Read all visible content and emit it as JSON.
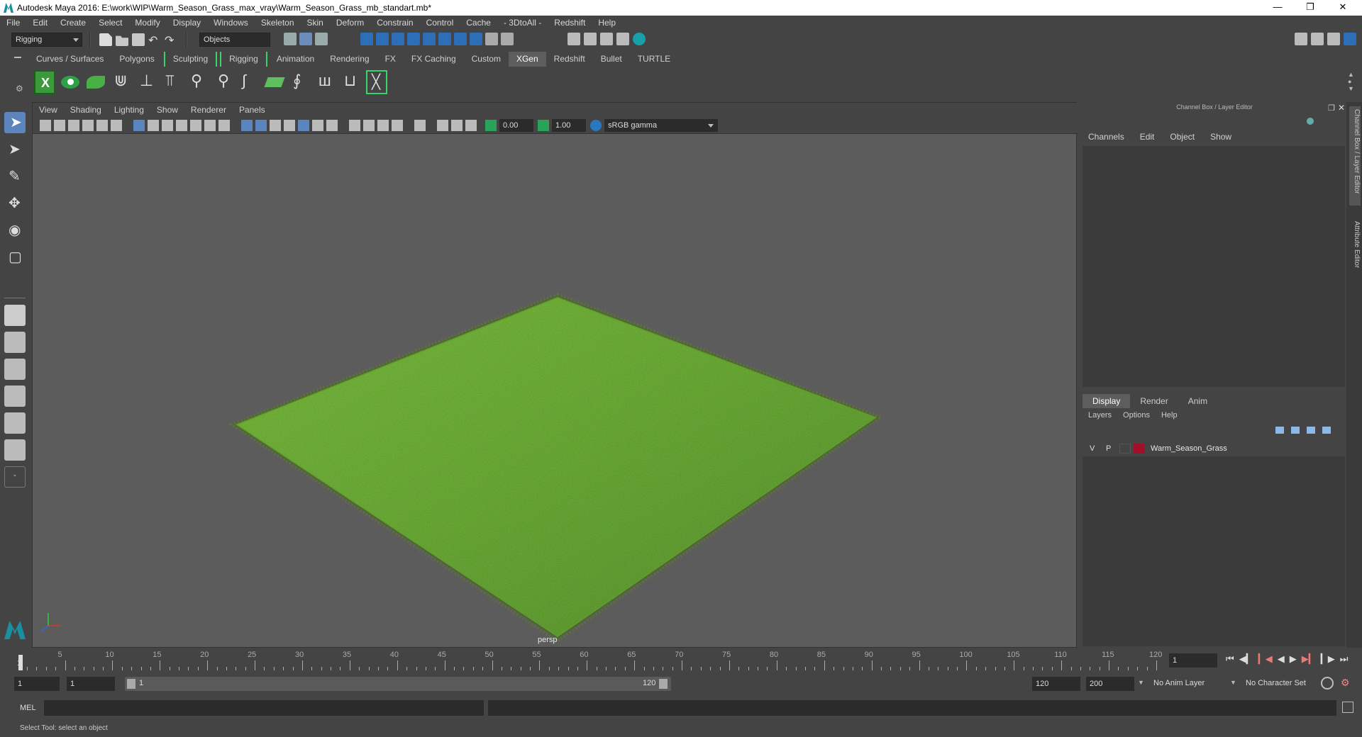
{
  "window": {
    "title": "Autodesk Maya 2016: E:\\work\\WIP\\Warm_Season_Grass_max_vray\\Warm_Season_Grass_mb_standart.mb*"
  },
  "menubar": [
    "File",
    "Edit",
    "Create",
    "Select",
    "Modify",
    "Display",
    "Windows",
    "Skeleton",
    "Skin",
    "Deform",
    "Constrain",
    "Control",
    "Cache",
    "- 3DtoAll -",
    "Redshift",
    "Help"
  ],
  "statusline": {
    "menuset": "Rigging",
    "selection_mode": "Objects"
  },
  "shelf_tabs": [
    {
      "label": "Curves / Surfaces",
      "active": false,
      "bracket": false
    },
    {
      "label": "Polygons",
      "active": false,
      "bracket": false
    },
    {
      "label": "Sculpting",
      "active": false,
      "bracket": true
    },
    {
      "label": "Rigging",
      "active": false,
      "bracket": true
    },
    {
      "label": "Animation",
      "active": false,
      "bracket": false
    },
    {
      "label": "Rendering",
      "active": false,
      "bracket": false
    },
    {
      "label": "FX",
      "active": false,
      "bracket": false
    },
    {
      "label": "FX Caching",
      "active": false,
      "bracket": false
    },
    {
      "label": "Custom",
      "active": false,
      "bracket": false
    },
    {
      "label": "XGen",
      "active": true,
      "bracket": false
    },
    {
      "label": "Redshift",
      "active": false,
      "bracket": false
    },
    {
      "label": "Bullet",
      "active": false,
      "bracket": false
    },
    {
      "label": "TURTLE",
      "active": false,
      "bracket": false
    }
  ],
  "viewport": {
    "menu": [
      "View",
      "Shading",
      "Lighting",
      "Show",
      "Renderer",
      "Panels"
    ],
    "exposure": "0.00",
    "gamma": "1.00",
    "color_space": "sRGB gamma",
    "camera_label": "persp",
    "colors": {
      "grass_dark": "#2f4a14",
      "grass_mid": "#4f7a23",
      "grass_light": "#6f9b34",
      "bg": "#5c5c5c"
    }
  },
  "channelbox": {
    "title": "Channel Box / Layer Editor",
    "menu": [
      "Channels",
      "Edit",
      "Object",
      "Show"
    ],
    "layer_tabs": [
      {
        "label": "Display",
        "active": true
      },
      {
        "label": "Render",
        "active": false
      },
      {
        "label": "Anim",
        "active": false
      }
    ],
    "layer_menu": [
      "Layers",
      "Options",
      "Help"
    ],
    "layers": [
      {
        "v": "V",
        "p": "P",
        "name": "Warm_Season_Grass",
        "color": "#a0102a"
      }
    ]
  },
  "side_tabs": [
    "Channel Box / Layer Editor",
    "Attribute Editor"
  ],
  "timeslider": {
    "start": 1,
    "end": 120,
    "current": 1,
    "tick_labels": [
      "5",
      "10",
      "15",
      "20",
      "25",
      "30",
      "35",
      "40",
      "45",
      "50",
      "55",
      "60",
      "65",
      "70",
      "75",
      "80",
      "85",
      "90",
      "95",
      "100",
      "105",
      "110",
      "115",
      "120"
    ],
    "current_frame_field": "1"
  },
  "range": {
    "start_field": "1",
    "playback_start": "1",
    "slider_start_label": "1",
    "slider_end_label": "120",
    "playback_end": "120",
    "end_field": "200",
    "anim_layer": "No Anim Layer",
    "character_set": "No Character Set"
  },
  "command": {
    "label": "MEL",
    "help": "Select Tool: select an object"
  }
}
